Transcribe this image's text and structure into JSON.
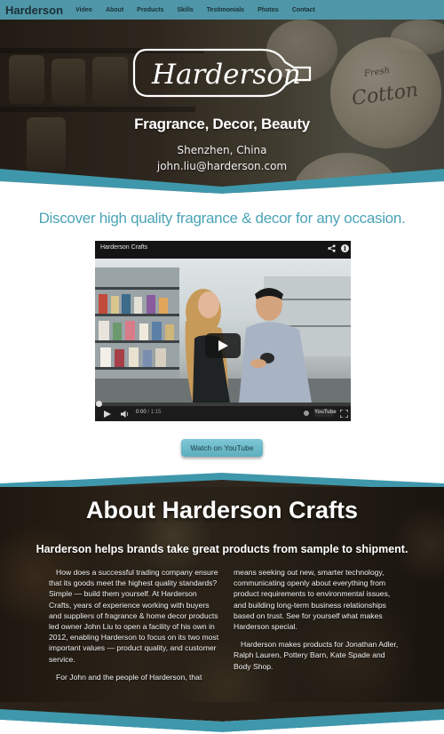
{
  "nav": {
    "brand": "Harderson",
    "links": [
      "Video",
      "About",
      "Products",
      "Skills",
      "Testimonials",
      "Photos",
      "Contact"
    ]
  },
  "hero": {
    "logo_text": "Harderson",
    "tagline": "Fragrance, Decor, Beauty",
    "location": "Shenzhen, China",
    "email": "john.liu@harderson.com",
    "tin_labels": [
      "Cotton",
      "Fresh"
    ]
  },
  "video_section": {
    "headline": "Discover high quality fragrance & decor for any occasion.",
    "video_title": "Harderson Crafts",
    "time_current": "0:00",
    "time_separator": "/",
    "time_total": "1:15",
    "progress_fraction": 0.0,
    "youtube_logo": "YouTube",
    "button_label": "Watch on YouTube"
  },
  "about": {
    "title": "About Harderson Crafts",
    "subtitle": "Harderson helps brands take great products from sample to shipment.",
    "left_paragraphs": [
      "How does a successful trading company ensure that its goods meet the highest quality standards? Simple — build them yourself. At Harderson Crafts, years of experience working with buyers and suppliers of fragrance & home decor products led owner John Liu to open a facility of his own in 2012, enabling Harderson to focus on its two most important values — product quality, and customer service.",
      "For John and the people of Harderson, that"
    ],
    "right_paragraphs": [
      "means seeking out new, smarter technology, communicating openly about everything from product requirements to environmental issues, and building long-term business relationships based on trust. See for yourself what makes Harderson special.",
      "Harderson makes products for Jonathan Adler, Ralph Lauren, Pottery Barn, Kate Spade and Body Shop."
    ]
  },
  "colors": {
    "nav_bg": "#4f97a8",
    "accent": "#4aa3b6",
    "wave": "#3f97ab",
    "button": "#6cbccb"
  }
}
